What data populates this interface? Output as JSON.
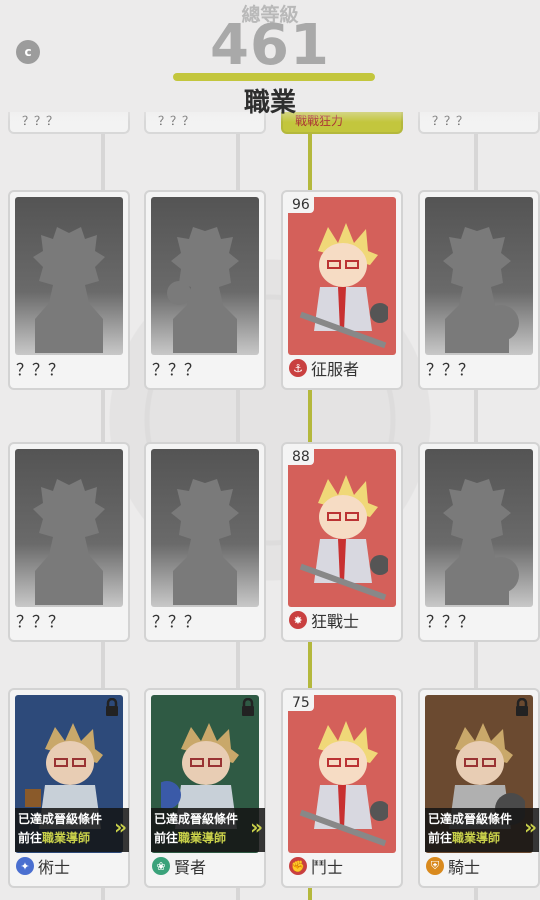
{
  "header": {
    "close_label": "c",
    "total_label": "總等級",
    "total_value": "461",
    "title": "職業"
  },
  "stubs": [
    {
      "text": "？？？",
      "active": false
    },
    {
      "text": "？？？",
      "active": false
    },
    {
      "text": "戰戰狂力",
      "active": true
    },
    {
      "text": "？？？",
      "active": false
    }
  ],
  "rows": [
    [
      {
        "label": "？？？",
        "locked_silhouette": true
      },
      {
        "label": "？？？",
        "locked_silhouette": true
      },
      {
        "label": "征服者",
        "level": "96",
        "color": "red"
      },
      {
        "label": "？？？",
        "locked_silhouette": true
      }
    ],
    [
      {
        "label": "？？？",
        "locked_silhouette": true
      },
      {
        "label": "？？？",
        "locked_silhouette": true
      },
      {
        "label": "狂戰士",
        "level": "88",
        "color": "red"
      },
      {
        "label": "？？？",
        "locked_silhouette": true
      }
    ],
    [
      {
        "label": "術士",
        "color": "blue",
        "locked": true,
        "banner": true
      },
      {
        "label": "賢者",
        "color": "green",
        "locked": true,
        "banner": true
      },
      {
        "label": "鬥士",
        "level": "75",
        "color": "red"
      },
      {
        "label": "騎士",
        "color": "brown",
        "locked": true,
        "banner": true
      }
    ]
  ],
  "banner": {
    "line1": "已達成晉級條件",
    "line2_prefix": "前往",
    "line2_link": "職業導師"
  },
  "colors": {
    "accent": "#c3c63d",
    "card_red": "#d4605a"
  }
}
